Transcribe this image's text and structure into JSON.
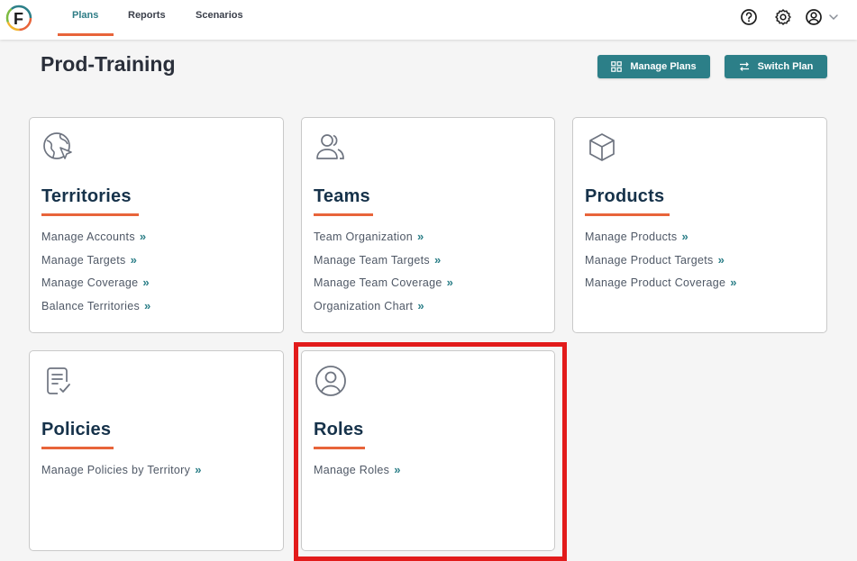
{
  "nav": {
    "tabs": [
      {
        "label": "Plans"
      },
      {
        "label": "Reports"
      },
      {
        "label": "Scenarios"
      }
    ]
  },
  "page": {
    "title": "Prod-Training",
    "manage_plans_label": "Manage Plans",
    "switch_plan_label": "Switch Plan"
  },
  "cards": {
    "territories": {
      "title": "Territories",
      "links": [
        "Manage Accounts",
        "Manage Targets",
        "Manage Coverage",
        "Balance Territories"
      ]
    },
    "teams": {
      "title": "Teams",
      "links": [
        "Team Organization",
        "Manage Team Targets",
        "Manage Team Coverage",
        "Organization Chart"
      ]
    },
    "products": {
      "title": "Products",
      "links": [
        "Manage Products",
        "Manage Product Targets",
        "Manage Product Coverage"
      ]
    },
    "policies": {
      "title": "Policies",
      "links": [
        "Manage Policies by Territory"
      ]
    },
    "roles": {
      "title": "Roles",
      "links": [
        "Manage Roles"
      ]
    }
  },
  "chevron": "»",
  "colors": {
    "accent": "#2c7f88",
    "underline": "#e8643a",
    "highlight": "#e21b1b",
    "title": "#16324a"
  }
}
